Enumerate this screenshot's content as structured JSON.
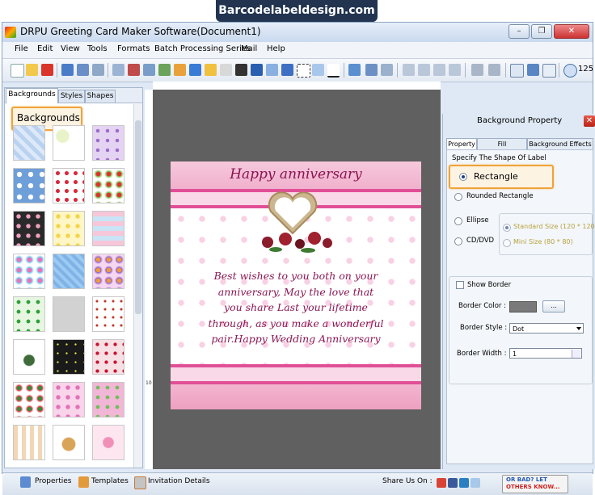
{
  "banner": "Barcodelabeldesign.com",
  "window": {
    "title": "DRPU Greeting Card Maker Software(Document1)"
  },
  "menu": [
    "File",
    "Edit",
    "View",
    "Tools",
    "Formats",
    "Batch Processing Series",
    "Mail",
    "Help"
  ],
  "toolbar": {
    "zoom": "125"
  },
  "left_panel": {
    "tabs": [
      "Backgrounds",
      "Styles",
      "Shapes"
    ],
    "active_tab": "Backgrounds",
    "callout": "Backgrounds"
  },
  "card": {
    "title": "Happy anniversary",
    "message": [
      "Best wishes to you both on your",
      "anniversary, May the love that",
      "you share Last your lifetime",
      "through, as you make a wonderful",
      "pair.Happy Wedding Anniversary"
    ]
  },
  "right_panel": {
    "header": "Background Property",
    "tabs": [
      "Property",
      "Fill Background",
      "Background Effects"
    ],
    "section": "Specify The Shape Of Label",
    "shapes": {
      "rectangle": "Rectangle",
      "rounded": "Rounded Rectangle",
      "ellipse": "Ellipse",
      "cddvd": "CD/DVD"
    },
    "sizes": {
      "standard": "Standard Size (120 * 120)",
      "mini": "Mini Size (80 * 80)"
    },
    "show_border": "Show Border",
    "border_color_label": "Border Color :",
    "border_color_btn": "...",
    "border_style_label": "Border Style :",
    "border_style_value": "Dot",
    "border_width_label": "Border Width :",
    "border_width_value": "1"
  },
  "status": {
    "properties": "Properties",
    "templates": "Templates",
    "invitation": "Invitation Details",
    "share": "Share Us On :",
    "feedback_line1": "OR BAD? LET",
    "feedback_line2": "OTHERS KNOW..."
  },
  "colors": {
    "accent_card": "#8a1552",
    "highlight": "#f0a33a",
    "canvas_bg": "#606060"
  }
}
